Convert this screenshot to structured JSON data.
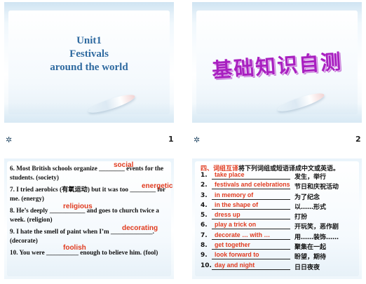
{
  "slides": [
    {
      "number": "1",
      "title_lines": [
        "Unit1",
        "Festivals",
        "around the world"
      ]
    },
    {
      "number": "2",
      "title": "基础知识自测"
    },
    {
      "questions": [
        {
          "text": "6. Most British schools organize ________ events for the students. (society)",
          "answer": "social"
        },
        {
          "text": "7. I tried aerobics (有氧运动) but it was too ________ for me. (energy)",
          "answer": "energetic"
        },
        {
          "text": "8. He’s deeply ___________ and goes to church twice a week. (religion)",
          "answer": "religious"
        },
        {
          "text": "9. I hate the smell of paint when I’m _____________. (decorate)",
          "answer": "decorating"
        },
        {
          "text": "10. You were __________ enough to believe him. (fool)",
          "answer": "foolish"
        }
      ]
    },
    {
      "heading_red": "四、词组互译",
      "heading_black": "将下列词组或短语译成中文或英语。",
      "rows": [
        {
          "n": "1.",
          "en": "take place",
          "zh": "发生，举行"
        },
        {
          "n": "2.",
          "en": "festivals and celebrations",
          "zh": "节日和庆祝活动"
        },
        {
          "n": "3.",
          "en": "in memory of",
          "zh": "为了纪念"
        },
        {
          "n": "4.",
          "en": "in the shape of",
          "zh": "以……形式"
        },
        {
          "n": "5.",
          "en": "dress up",
          "zh": "打扮"
        },
        {
          "n": "6.",
          "en": "play a trick on",
          "zh": "开玩笑，恶作剧"
        },
        {
          "n": "7.",
          "en": "decorate … with …",
          "zh": "用……装饰……"
        },
        {
          "n": "8.",
          "en": "get together",
          "zh": "聚集在一起"
        },
        {
          "n": "9.",
          "en": "look forward to",
          "zh": "盼望，期待"
        },
        {
          "n": "10.",
          "en": "day and night",
          "zh": "日日夜夜"
        }
      ]
    }
  ],
  "icons": {
    "snowflake": "snowflake-icon"
  },
  "colors": {
    "title_blue": "#2f6aa0",
    "title_purple": "#a820c0",
    "answer_red": "#e03a1e"
  }
}
